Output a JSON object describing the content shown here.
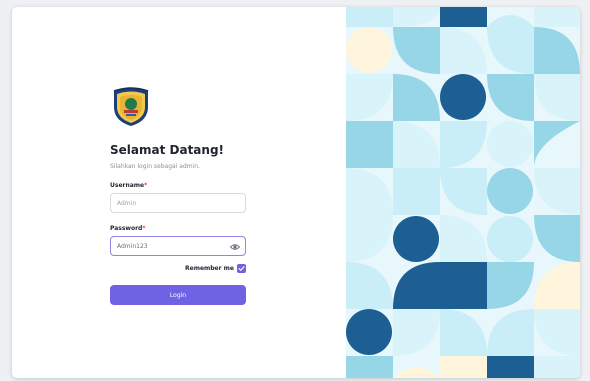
{
  "login": {
    "title": "Selamat Datang!",
    "subtitle": "Silahkan login sebagai admin.",
    "username_label": "Username",
    "username_placeholder": "Admin",
    "password_label": "Password",
    "password_value": "Admin123",
    "required_mark": "*",
    "remember_label": "Remember me",
    "remember_checked": true,
    "submit_label": "Login"
  },
  "icons": {
    "logo": "seal-logo",
    "password_toggle": "eye-icon",
    "checkbox": "check-icon"
  },
  "colors": {
    "accent": "#6f63e3",
    "pattern_dark": "#1d5f93",
    "pattern_mid": "#96d6e6",
    "pattern_light": "#c9eef7",
    "pattern_cream": "#fff4dc"
  }
}
